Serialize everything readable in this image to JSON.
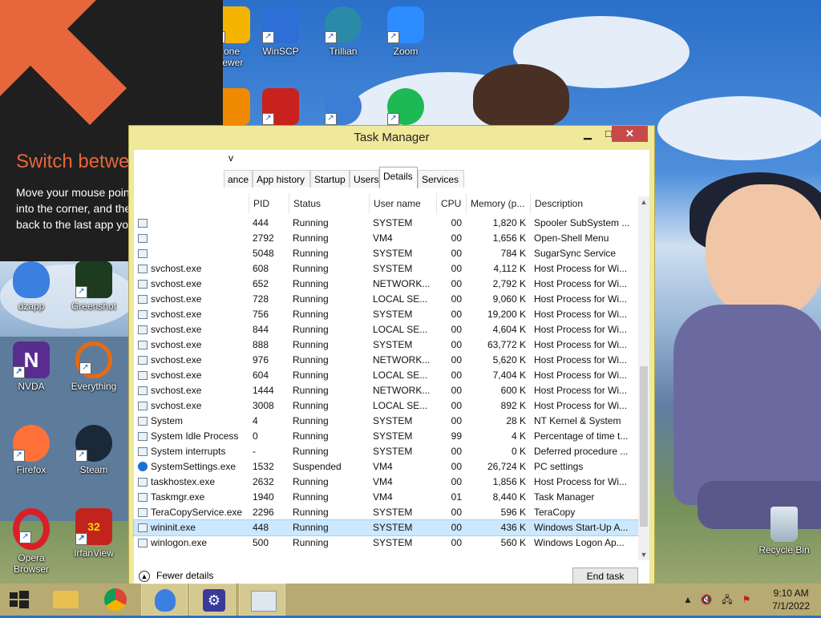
{
  "desktop": {
    "icons_top": [
      {
        "label": "one\niewer",
        "color": "#f5b400"
      },
      {
        "label": "WinSCP",
        "color": "#2d6fd6"
      },
      {
        "label": "Trillian",
        "color": "#2a8aa7"
      },
      {
        "label": "Zoom",
        "color": "#2d8cff"
      }
    ],
    "icons_row2": [
      {
        "label": "",
        "color": "#f08a00"
      },
      {
        "label": "",
        "color": "#c8211e"
      },
      {
        "label": "",
        "color": "#3c7ed6"
      },
      {
        "label": "",
        "color": "#1db954"
      }
    ],
    "icons_left": [
      {
        "label": "dzapp",
        "color": "#3b7fe0"
      },
      {
        "label": "Greenshot",
        "color": "#2f7d32"
      },
      {
        "label": "NVDA",
        "color": "#5b2c8f"
      },
      {
        "label": "Everything",
        "color": "#e86a10"
      },
      {
        "label": "Firefox",
        "color": "#ff7139"
      },
      {
        "label": "Steam",
        "color": "#1b2838"
      },
      {
        "label": "Opera\nBrowser",
        "color": "#d91f26"
      },
      {
        "label": "IrfanView",
        "color": "#c3231d"
      }
    ],
    "recycle_bin": "Recycle Bin"
  },
  "tip": {
    "title": "Switch between apps",
    "body": "Move your mouse pointer all the way into the corner, and then click to go back to the last app you were using.",
    "accent": "#e8663b"
  },
  "window": {
    "title": "Task Manager",
    "menu_fragment": "v",
    "minimize": "▁",
    "maximize": "□",
    "close": "✕",
    "tabs": [
      "ance",
      "App history",
      "Startup",
      "Users",
      "Details",
      "Services"
    ],
    "active_tab": "Details",
    "columns": [
      "PID",
      "Status",
      "User name",
      "CPU",
      "Memory (p...",
      "Description"
    ],
    "rows": [
      {
        "name": "",
        "pid": "444",
        "status": "Running",
        "user": "SYSTEM",
        "cpu": "00",
        "mem": "1,820 K",
        "desc": "Spooler SubSystem ..."
      },
      {
        "name": "",
        "pid": "2792",
        "status": "Running",
        "user": "VM4",
        "cpu": "00",
        "mem": "1,656 K",
        "desc": "Open-Shell Menu"
      },
      {
        "name": "",
        "pid": "5048",
        "status": "Running",
        "user": "SYSTEM",
        "cpu": "00",
        "mem": "784 K",
        "desc": "SugarSync Service"
      },
      {
        "name": "svchost.exe",
        "pid": "608",
        "status": "Running",
        "user": "SYSTEM",
        "cpu": "00",
        "mem": "4,112 K",
        "desc": "Host Process for Wi..."
      },
      {
        "name": "svchost.exe",
        "pid": "652",
        "status": "Running",
        "user": "NETWORK...",
        "cpu": "00",
        "mem": "2,792 K",
        "desc": "Host Process for Wi..."
      },
      {
        "name": "svchost.exe",
        "pid": "728",
        "status": "Running",
        "user": "LOCAL SE...",
        "cpu": "00",
        "mem": "9,060 K",
        "desc": "Host Process for Wi..."
      },
      {
        "name": "svchost.exe",
        "pid": "756",
        "status": "Running",
        "user": "SYSTEM",
        "cpu": "00",
        "mem": "19,200 K",
        "desc": "Host Process for Wi..."
      },
      {
        "name": "svchost.exe",
        "pid": "844",
        "status": "Running",
        "user": "LOCAL SE...",
        "cpu": "00",
        "mem": "4,604 K",
        "desc": "Host Process for Wi..."
      },
      {
        "name": "svchost.exe",
        "pid": "888",
        "status": "Running",
        "user": "SYSTEM",
        "cpu": "00",
        "mem": "63,772 K",
        "desc": "Host Process for Wi..."
      },
      {
        "name": "svchost.exe",
        "pid": "976",
        "status": "Running",
        "user": "NETWORK...",
        "cpu": "00",
        "mem": "5,620 K",
        "desc": "Host Process for Wi..."
      },
      {
        "name": "svchost.exe",
        "pid": "604",
        "status": "Running",
        "user": "LOCAL SE...",
        "cpu": "00",
        "mem": "7,404 K",
        "desc": "Host Process for Wi..."
      },
      {
        "name": "svchost.exe",
        "pid": "1444",
        "status": "Running",
        "user": "NETWORK...",
        "cpu": "00",
        "mem": "600 K",
        "desc": "Host Process for Wi..."
      },
      {
        "name": "svchost.exe",
        "pid": "3008",
        "status": "Running",
        "user": "LOCAL SE...",
        "cpu": "00",
        "mem": "892 K",
        "desc": "Host Process for Wi..."
      },
      {
        "name": "System",
        "pid": "4",
        "status": "Running",
        "user": "SYSTEM",
        "cpu": "00",
        "mem": "28 K",
        "desc": "NT Kernel & System"
      },
      {
        "name": "System Idle Process",
        "pid": "0",
        "status": "Running",
        "user": "SYSTEM",
        "cpu": "99",
        "mem": "4 K",
        "desc": "Percentage of time t..."
      },
      {
        "name": "System interrupts",
        "pid": "-",
        "status": "Running",
        "user": "SYSTEM",
        "cpu": "00",
        "mem": "0 K",
        "desc": "Deferred procedure ..."
      },
      {
        "name": "SystemSettings.exe",
        "pid": "1532",
        "status": "Suspended",
        "user": "VM4",
        "cpu": "00",
        "mem": "26,724 K",
        "desc": "PC settings",
        "icon": "gear"
      },
      {
        "name": "taskhostex.exe",
        "pid": "2632",
        "status": "Running",
        "user": "VM4",
        "cpu": "00",
        "mem": "1,856 K",
        "desc": "Host Process for Wi..."
      },
      {
        "name": "Taskmgr.exe",
        "pid": "1940",
        "status": "Running",
        "user": "VM4",
        "cpu": "01",
        "mem": "8,440 K",
        "desc": "Task Manager"
      },
      {
        "name": "TeraCopyService.exe",
        "pid": "2296",
        "status": "Running",
        "user": "SYSTEM",
        "cpu": "00",
        "mem": "596 K",
        "desc": "TeraCopy"
      },
      {
        "name": "wininit.exe",
        "pid": "448",
        "status": "Running",
        "user": "SYSTEM",
        "cpu": "00",
        "mem": "436 K",
        "desc": "Windows Start-Up A...",
        "selected": true
      },
      {
        "name": "winlogon.exe",
        "pid": "500",
        "status": "Running",
        "user": "SYSTEM",
        "cpu": "00",
        "mem": "560 K",
        "desc": "Windows Logon Ap..."
      }
    ],
    "fewer_details": "Fewer details",
    "end_task": "End task"
  },
  "taskbar": {
    "clock_time": "9:10 AM",
    "clock_date": "7/1/2022",
    "tray_chevron": "▲",
    "pinned": [
      "start",
      "file-explorer",
      "chrome",
      "dzapp",
      "settings",
      "task-manager"
    ]
  }
}
